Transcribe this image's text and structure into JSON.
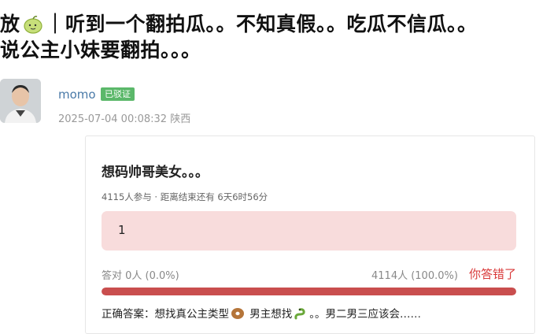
{
  "post": {
    "title_line1_pre": "放",
    "title_line1_post": "｜听到一个翻拍瓜。。不知真假。。吃瓜不信瓜。。",
    "title_line2": "说公主小妹要翻拍。。。",
    "emoji_name": "melon-icon"
  },
  "author": {
    "name": "momo",
    "badge": "已驳证",
    "timestamp": "2025-07-04 00:08:32 陕西"
  },
  "poll": {
    "question": "想码帅哥美女。。。",
    "stats": "4115人参与 · 距离结束还有 6天6时56分",
    "option_label": "1",
    "correct_label": "答对 0人 (0.0%)",
    "wrong_count": "4114人 (100.0%)",
    "wrong_label": "你答错了",
    "wrong_fraction": 1.0,
    "answer_pre": "正确答案：想找真公主类型",
    "answer_mid": "男主想找",
    "answer_post": "。。男二男三应该会……"
  },
  "colors": {
    "link": "#4a7aa8",
    "badge": "#5bb86a",
    "option_bg": "#f8dcdc",
    "bar_fill": "#c94e4e",
    "wrong": "#d93a3a"
  }
}
